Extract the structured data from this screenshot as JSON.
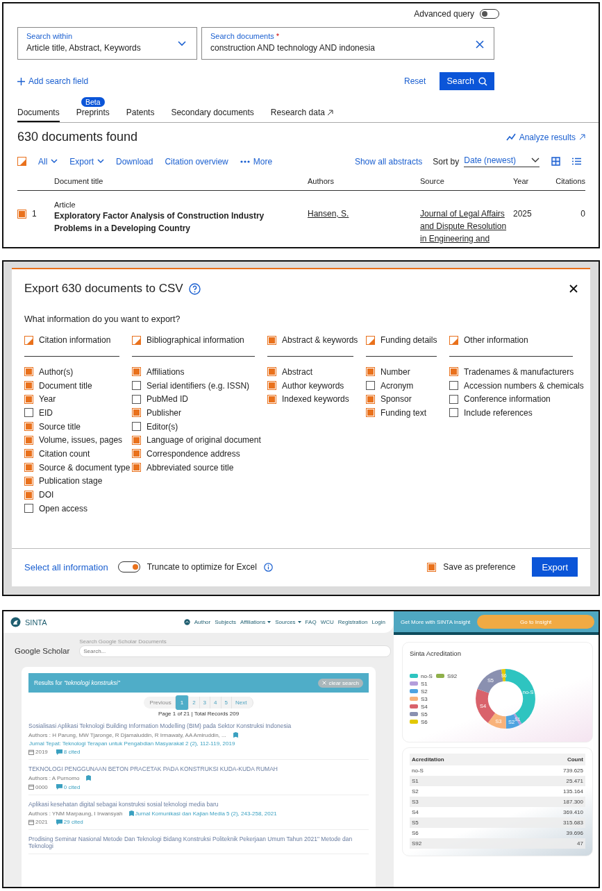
{
  "search_page": {
    "advanced_query": {
      "label": "Advanced query",
      "on": false
    },
    "search_within": {
      "label": "Search within",
      "value": "Article title, Abstract, Keywords"
    },
    "search_documents": {
      "label": "Search documents",
      "required_mark": "*",
      "value": "construction AND technology AND indonesia"
    },
    "add_field": "Add search field",
    "reset": "Reset",
    "search_button": "Search",
    "tabs": [
      {
        "label": "Documents",
        "selected": true,
        "external": false
      },
      {
        "label": "Preprints",
        "selected": false,
        "badge": "Beta",
        "external": false
      },
      {
        "label": "Patents",
        "selected": false,
        "external": false
      },
      {
        "label": "Secondary documents",
        "selected": false,
        "external": false
      },
      {
        "label": "Research data",
        "selected": false,
        "external": true
      }
    ],
    "results_count": "630 documents found",
    "analyze": "Analyze results",
    "toolbar": {
      "select_all": {
        "indeterminate": true
      },
      "all": "All",
      "export": "Export",
      "download": "Download",
      "citation_overview": "Citation overview",
      "more": "More",
      "show_abstracts": "Show all abstracts",
      "sort_label": "Sort by",
      "sort_value": "Date (newest)",
      "views": [
        {
          "kind": "grid",
          "selected": true
        },
        {
          "kind": "list",
          "selected": false
        }
      ]
    },
    "table": {
      "columns": [
        "Document title",
        "Authors",
        "Source",
        "Year",
        "Citations"
      ],
      "rows": [
        {
          "checked": true,
          "index": "1",
          "type": "Article",
          "title": "Exploratory Factor Analysis of Construction Industry Problems in a Developing Country",
          "authors": "Hansen, S.",
          "source": "Journal of Legal Affairs and Dispute Resolution in Engineering and",
          "year": "2025",
          "citations": "0"
        }
      ]
    }
  },
  "export_dialog": {
    "title": "Export 630 documents to CSV",
    "question": "What information do you want to export?",
    "groups": [
      {
        "label": "Citation information",
        "indeterminate": true,
        "items": [
          {
            "label": "Author(s)",
            "checked": true
          },
          {
            "label": "Document title",
            "checked": true
          },
          {
            "label": "Year",
            "checked": true
          },
          {
            "label": "EID",
            "checked": false
          },
          {
            "label": "Source title",
            "checked": true
          },
          {
            "label": "Volume, issues, pages",
            "checked": true
          },
          {
            "label": "Citation count",
            "checked": true
          },
          {
            "label": "Source & document type",
            "checked": true
          },
          {
            "label": "Publication stage",
            "checked": true
          },
          {
            "label": "DOI",
            "checked": true
          },
          {
            "label": "Open access",
            "checked": false
          }
        ]
      },
      {
        "label": "Bibliographical information",
        "indeterminate": true,
        "items": [
          {
            "label": "Affiliations",
            "checked": true
          },
          {
            "label": "Serial identifiers (e.g. ISSN)",
            "checked": false
          },
          {
            "label": "PubMed ID",
            "checked": false
          },
          {
            "label": "Publisher",
            "checked": true
          },
          {
            "label": "Editor(s)",
            "checked": false
          },
          {
            "label": "Language of original document",
            "checked": true
          },
          {
            "label": "Correspondence address",
            "checked": true
          },
          {
            "label": "Abbreviated source title",
            "checked": true
          }
        ]
      },
      {
        "label": "Abstract & keywords",
        "checked": true,
        "items": [
          {
            "label": "Abstract",
            "checked": true
          },
          {
            "label": "Author keywords",
            "checked": true
          },
          {
            "label": "Indexed keywords",
            "checked": true
          }
        ]
      },
      {
        "label": "Funding details",
        "indeterminate": true,
        "items": [
          {
            "label": "Number",
            "checked": true
          },
          {
            "label": "Acronym",
            "checked": false
          },
          {
            "label": "Sponsor",
            "checked": true
          },
          {
            "label": "Funding text",
            "checked": true
          }
        ]
      },
      {
        "label": "Other information",
        "indeterminate": true,
        "items": [
          {
            "label": "Tradenames & manufacturers",
            "checked": true
          },
          {
            "label": "Accession numbers & chemicals",
            "checked": false
          },
          {
            "label": "Conference information",
            "checked": false
          },
          {
            "label": "Include references",
            "checked": false
          }
        ]
      }
    ],
    "select_all": "Select all information",
    "truncate": {
      "label": "Truncate to optimize for Excel",
      "on": true
    },
    "save_preference": {
      "label": "Save as preference",
      "checked": true
    },
    "export_button": "Export"
  },
  "sinta": {
    "brand": "SINTA",
    "nav": [
      {
        "label": "Author",
        "dropdown": false
      },
      {
        "label": "Subjects",
        "dropdown": false
      },
      {
        "label": "Affiliations",
        "dropdown": true
      },
      {
        "label": "Sources",
        "dropdown": true
      },
      {
        "label": "FAQ",
        "dropdown": false
      },
      {
        "label": "WCU",
        "dropdown": false
      },
      {
        "label": "Registration",
        "dropdown": false
      },
      {
        "label": "Login",
        "dropdown": false
      }
    ],
    "insight": {
      "text": "Get More with SINTA Insight",
      "button": "Go to Insight"
    },
    "page_title": "Google Scholar",
    "search": {
      "label": "Search Google Scholar Documents",
      "placeholder": "Search..."
    },
    "results_banner": "Results for *\"teknologi konstruksi\"*",
    "clear_search": "clear search",
    "pagination": {
      "previous": "Previous",
      "next": "Next",
      "pages": [
        {
          "label": "1",
          "selected": true
        },
        {
          "label": "2",
          "selected": false
        },
        {
          "label": "3",
          "selected": false
        },
        {
          "label": "4",
          "selected": false
        },
        {
          "label": "5",
          "selected": false
        }
      ]
    },
    "page_info": "Page 1 of 21 | Total Records 209",
    "results": [
      {
        "title": "Sosialisasi Aplikasi Teknologi Building Information Modelling (BIM) pada Sektor Konstruksi Indonesia",
        "authors": "Authors : H Parung, MW Tjaronge, R Djamaluddin, R Irmawaty, AA Amiruddin, ...",
        "journal": "Jurnal Tepat: Teknologi Terapan untuk Pengabdian Masyarakat 2 (2), 112-119, 2019",
        "year": "2019",
        "cited": "8 cited"
      },
      {
        "title": "TEKNOLOGI PENGGUNAAN BETON PRACETAK PADA KONSTRUKSI KUDA-KUDA RUMAH",
        "authors": "Authors : A Purnomo",
        "year": "0000",
        "cited": "0 cited"
      },
      {
        "title": "Aplikasi kesehatan digital sebagai konstruksi sosial teknologi media baru",
        "authors": "Authors : YNM Marpaung, I Irwansyah",
        "journal": "Jurnal Komunikasi dan Kajian Media 5 (2), 243-258, 2021",
        "year": "2021",
        "cited": "29 cited"
      },
      {
        "title": "Prodising Seminar Nasional Metode Dan Teknologi Bidang Konstruksi Politeknik Pekerjaan Umum Tahun 2021\" Metode dan Teknologi"
      }
    ],
    "accreditation": {
      "title": "Sinta Acreditation",
      "legend": [
        {
          "label": "no-S",
          "color": "#2ec4c0"
        },
        {
          "label": "S92",
          "color": "#8fb04a"
        },
        {
          "label": "S1",
          "color": "#b39ddb"
        },
        {
          "label": "S2",
          "color": "#4fa3e0"
        },
        {
          "label": "S3",
          "color": "#f8b27a"
        },
        {
          "label": "S4",
          "color": "#d9626b"
        },
        {
          "label": "S5",
          "color": "#8a90b0"
        },
        {
          "label": "S6",
          "color": "#e2c800"
        }
      ],
      "chart_data": {
        "type": "donut",
        "categories": [
          "no-S",
          "S1",
          "S2",
          "S3",
          "S4",
          "S5",
          "S6"
        ],
        "colors": [
          "#2ec4c0",
          "#b39ddb",
          "#4fa3e0",
          "#f8b27a",
          "#d9626b",
          "#8a90b0",
          "#e2c800"
        ],
        "series": [
          {
            "values": [
              40.81,
              1.41,
              7.46,
              10.33,
              20.38,
              17.42,
              2.19
            ]
          }
        ]
      }
    },
    "count_table": {
      "columns": [
        "Acreditation",
        "Count"
      ],
      "rows": [
        [
          "no-S",
          "739.625"
        ],
        [
          "S1",
          "25.471"
        ],
        [
          "S2",
          "135.164"
        ],
        [
          "S3",
          "187.300"
        ],
        [
          "S4",
          "369.410"
        ],
        [
          "S5",
          "315.683"
        ],
        [
          "S6",
          "39.696"
        ],
        [
          "S92",
          "47"
        ]
      ]
    }
  }
}
